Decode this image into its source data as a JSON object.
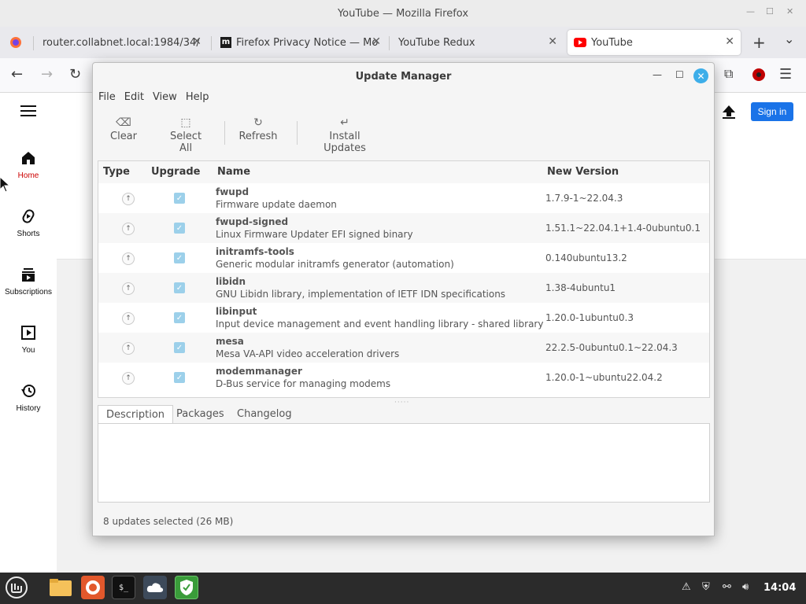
{
  "firefox": {
    "window_title": "YouTube — Mozilla Firefox",
    "tabs": [
      {
        "label": "router.collabnet.local:1984/34/",
        "active": false
      },
      {
        "label": "Firefox Privacy Notice — Mo",
        "active": false
      },
      {
        "label": "YouTube Redux",
        "active": false
      },
      {
        "label": "YouTube",
        "active": true
      }
    ],
    "new_tab_glyph": "+",
    "tab_list_glyph": "⌄",
    "close_glyph": "✕"
  },
  "youtube": {
    "sidebar": [
      {
        "label": "Home",
        "icon": "home-icon",
        "active": true
      },
      {
        "label": "Shorts",
        "icon": "shorts-icon"
      },
      {
        "label": "Subscriptions",
        "icon": "subscriptions-icon"
      },
      {
        "label": "You",
        "icon": "you-icon"
      },
      {
        "label": "History",
        "icon": "history-icon"
      }
    ],
    "sign_in_label": "Sign in",
    "brand_color": "#1a73e8",
    "active_color": "#cc0000"
  },
  "update_manager": {
    "title": "Update Manager",
    "menu": [
      "File",
      "Edit",
      "View",
      "Help"
    ],
    "toolbar": {
      "clear": "Clear",
      "select_all": "Select All",
      "refresh": "Refresh",
      "install": "Install Updates"
    },
    "columns": {
      "type": "Type",
      "upgrade": "Upgrade",
      "name": "Name",
      "version": "New Version"
    },
    "rows": [
      {
        "name": "fwupd",
        "desc": "Firmware update daemon",
        "version": "1.7.9-1~22.04.3",
        "checked": true
      },
      {
        "name": "fwupd-signed",
        "desc": "Linux Firmware Updater EFI signed binary",
        "version": "1.51.1~22.04.1+1.4-0ubuntu0.1",
        "checked": true
      },
      {
        "name": "initramfs-tools",
        "desc": "Generic modular initramfs generator (automation)",
        "version": "0.140ubuntu13.2",
        "checked": true
      },
      {
        "name": "libidn",
        "desc": "GNU Libidn library, implementation of IETF IDN specifications",
        "version": "1.38-4ubuntu1",
        "checked": true
      },
      {
        "name": "libinput",
        "desc": "Input device management and event handling library - shared library",
        "version": "1.20.0-1ubuntu0.3",
        "checked": true
      },
      {
        "name": "mesa",
        "desc": "Mesa VA-API video acceleration drivers",
        "version": "22.2.5-0ubuntu0.1~22.04.3",
        "checked": true
      },
      {
        "name": "modemmanager",
        "desc": "D-Bus service for managing modems",
        "version": "1.20.0-1~ubuntu22.04.2",
        "checked": true
      }
    ],
    "detail_tabs": [
      "Description",
      "Packages",
      "Changelog"
    ],
    "status": "8 updates selected (26 MB)",
    "accent": "#3daee9"
  },
  "taskbar": {
    "clock": "14:04"
  }
}
